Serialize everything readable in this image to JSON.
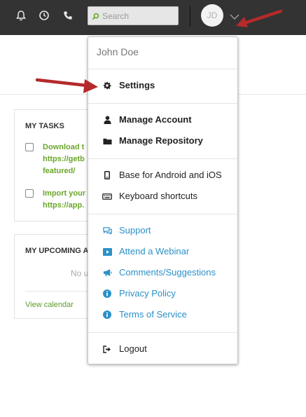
{
  "topbar": {
    "icons": [
      "bell-icon",
      "clock-icon",
      "phone-icon"
    ],
    "search": {
      "placeholder": "Search"
    },
    "avatar": {
      "initials": "JD"
    }
  },
  "background": {
    "tasks_card": {
      "title": "MY TASKS",
      "tasks": [
        {
          "lines": [
            "Download t",
            "https://getb",
            "featured/"
          ]
        },
        {
          "lines": [
            "Import your",
            "https://app."
          ]
        }
      ]
    },
    "upcoming_card": {
      "title": "MY UPCOMING A",
      "empty_text": "No u",
      "link": "View calendar"
    }
  },
  "menu": {
    "user_name": "John Doe",
    "groups": [
      [
        {
          "label": "Settings",
          "icon": "gear-icon"
        }
      ],
      [
        {
          "label": "Manage Account",
          "icon": "user-icon"
        },
        {
          "label": "Manage Repository",
          "icon": "folder-icon"
        }
      ],
      [
        {
          "label": "Base for Android and iOS",
          "icon": "mobile-icon"
        },
        {
          "label": "Keyboard shortcuts",
          "icon": "keyboard-icon"
        }
      ],
      [
        {
          "label": "Support",
          "icon": "chat-icon"
        },
        {
          "label": "Attend a Webinar",
          "icon": "video-icon"
        },
        {
          "label": "Comments/Suggestions",
          "icon": "megaphone-icon"
        },
        {
          "label": "Privacy Policy",
          "icon": "info-icon"
        },
        {
          "label": "Terms of Service",
          "icon": "info-icon"
        }
      ],
      [
        {
          "label": "Logout",
          "icon": "logout-icon"
        }
      ]
    ]
  },
  "colors": {
    "topbar": "#333333",
    "link_blue": "#2a91c8",
    "task_green": "#6aa62a",
    "annotation_arrow": "#b52a2a"
  }
}
